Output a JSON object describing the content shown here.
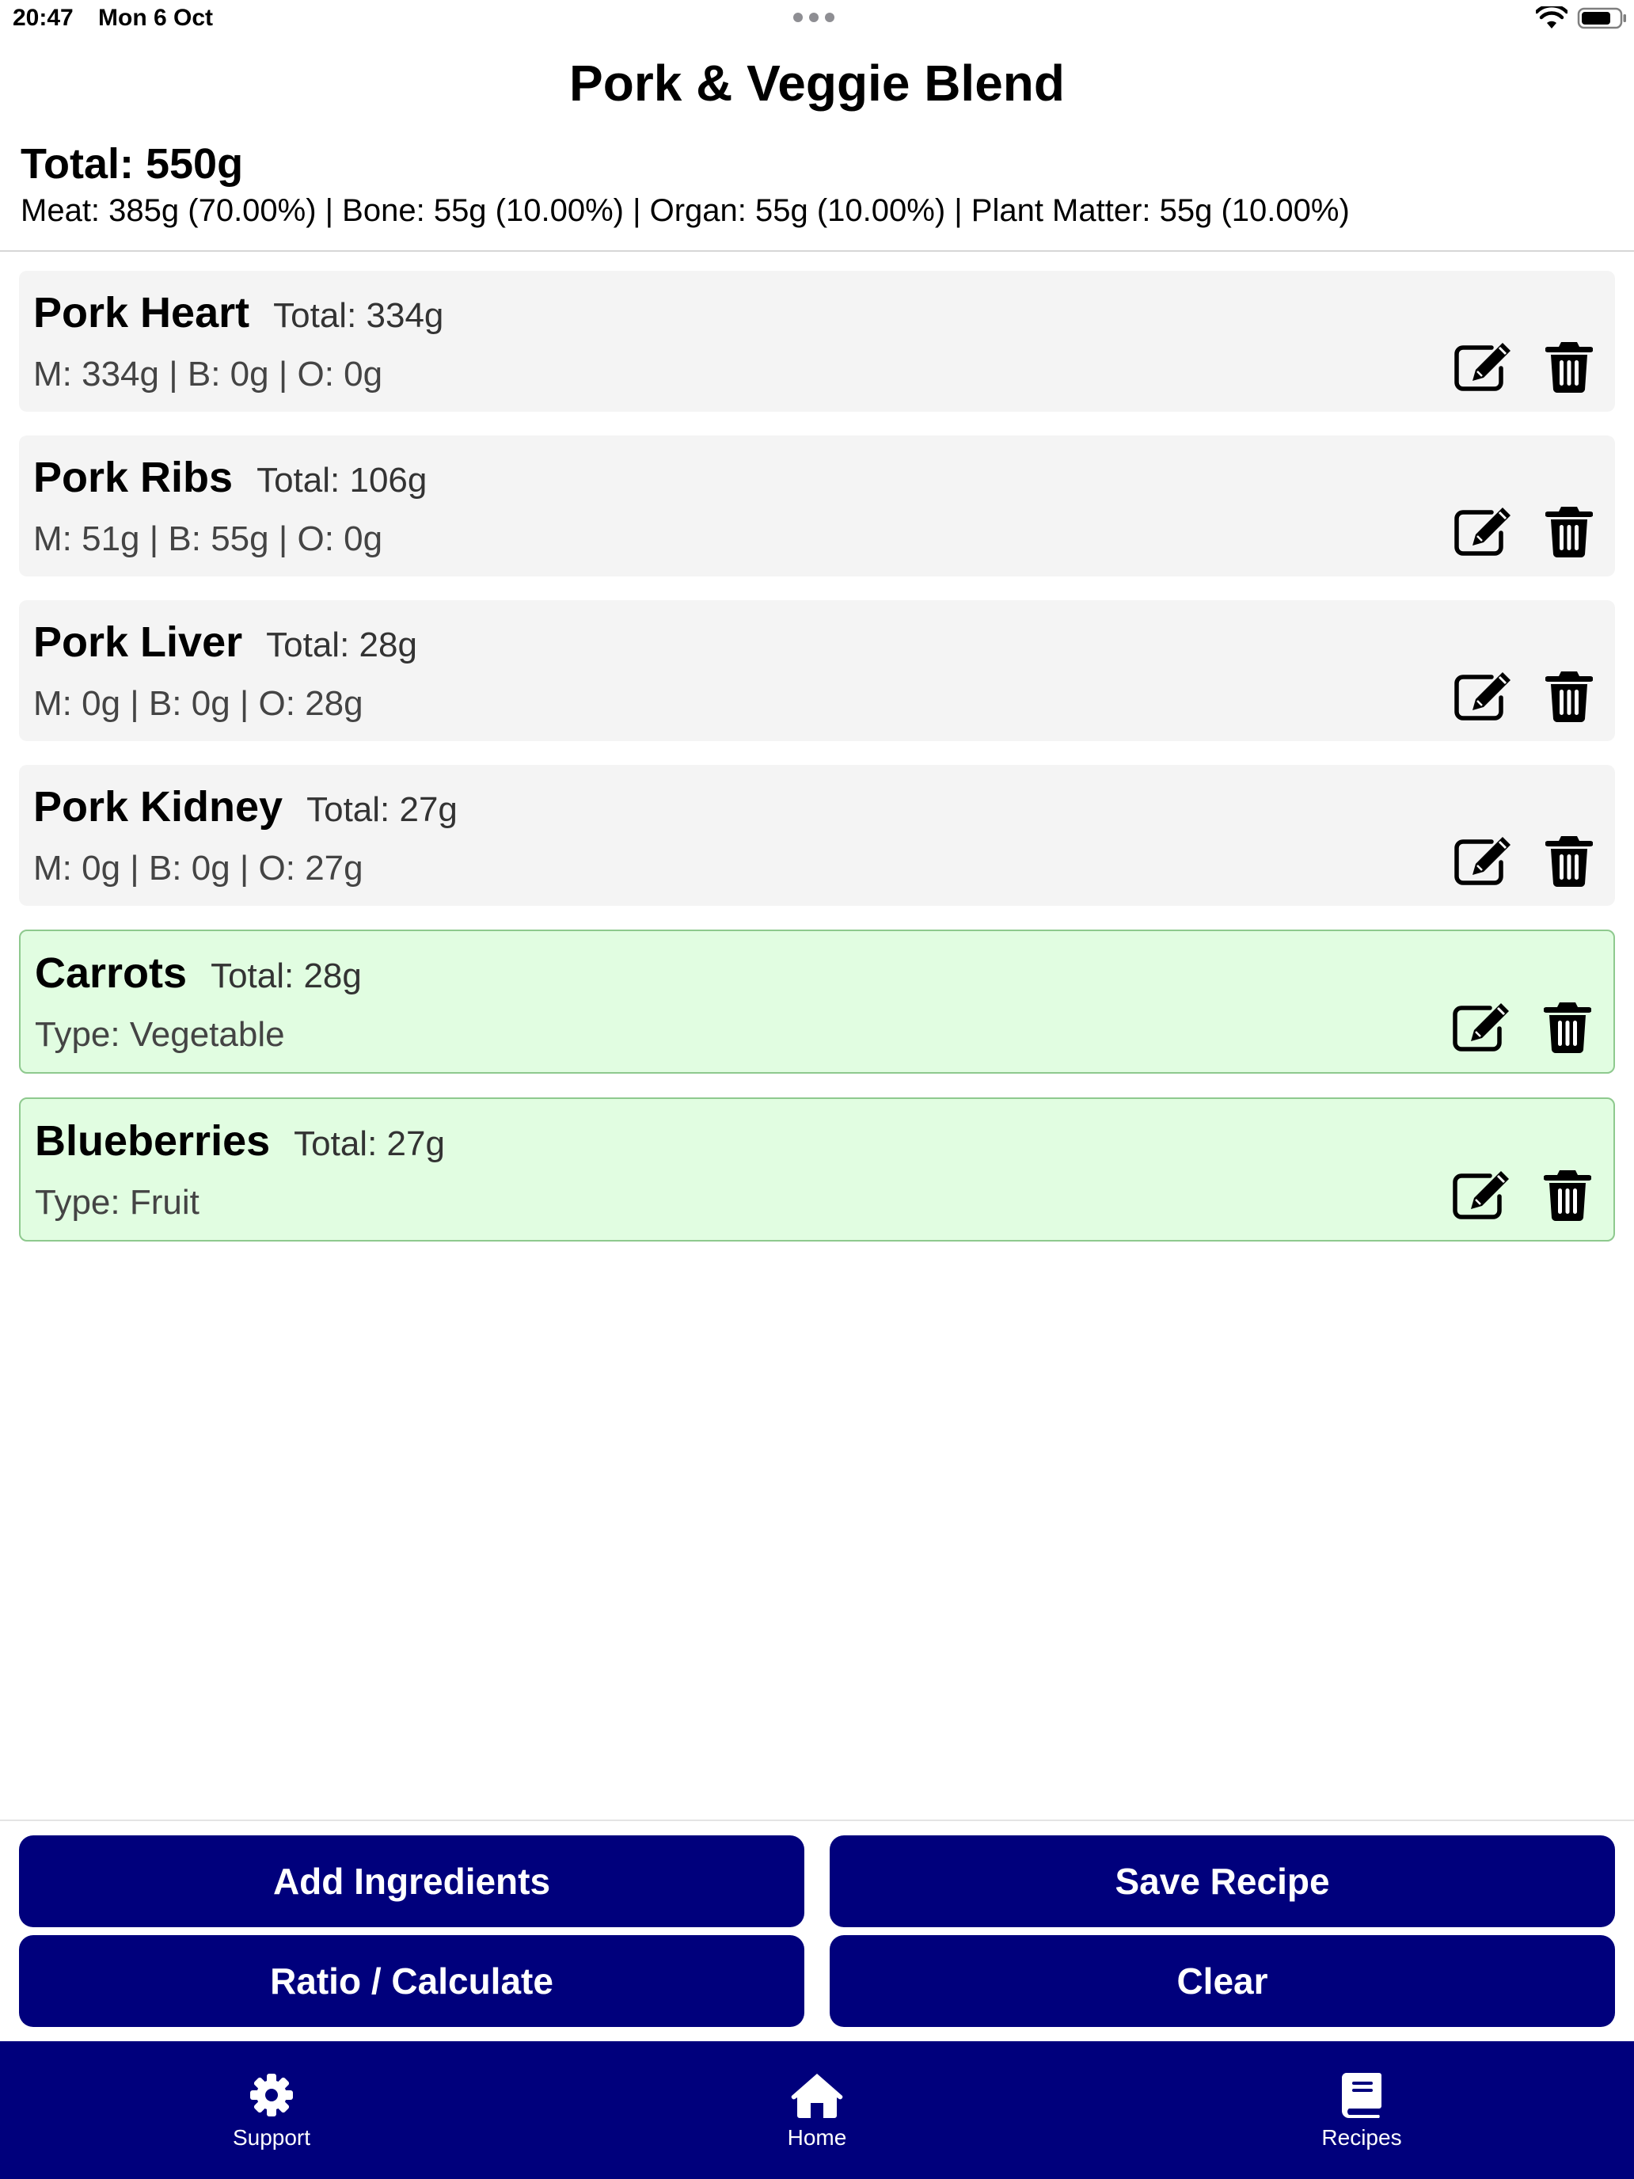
{
  "status_bar": {
    "time": "20:47",
    "date": "Mon 6 Oct"
  },
  "recipe": {
    "title": "Pork & Veggie Blend",
    "total": "Total: 550g",
    "breakdown": "Meat: 385g (70.00%) | Bone: 55g (10.00%) | Organ: 55g (10.00%) | Plant Matter: 55g (10.00%)"
  },
  "ingredients": [
    {
      "name": "Pork Heart",
      "total": "Total: 334g",
      "detail": "M: 334g | B: 0g | O: 0g",
      "kind": "animal"
    },
    {
      "name": "Pork Ribs",
      "total": "Total: 106g",
      "detail": "M: 51g | B: 55g | O: 0g",
      "kind": "animal"
    },
    {
      "name": "Pork Liver",
      "total": "Total: 28g",
      "detail": "M: 0g | B: 0g | O: 28g",
      "kind": "animal"
    },
    {
      "name": "Pork Kidney",
      "total": "Total: 27g",
      "detail": "M: 0g | B: 0g | O: 27g",
      "kind": "animal"
    },
    {
      "name": "Carrots",
      "total": "Total: 28g",
      "detail": "Type: Vegetable",
      "kind": "plant"
    },
    {
      "name": "Blueberries",
      "total": "Total: 27g",
      "detail": "Type: Fruit",
      "kind": "plant"
    }
  ],
  "actions": {
    "add_ingredients": "Add Ingredients",
    "save_recipe": "Save Recipe",
    "ratio_calculate": "Ratio / Calculate",
    "clear": "Clear"
  },
  "tabs": {
    "support": "Support",
    "home": "Home",
    "recipes": "Recipes"
  },
  "colors": {
    "brand_navy": "#00007c",
    "plant_card_bg": "#e1fde1",
    "plant_card_border": "#8ec98e",
    "animal_card_bg": "#f4f4f4"
  },
  "icons": {
    "edit": "edit-icon",
    "delete": "trash-icon",
    "support": "gear-icon",
    "home": "home-icon",
    "recipes": "book-icon"
  }
}
